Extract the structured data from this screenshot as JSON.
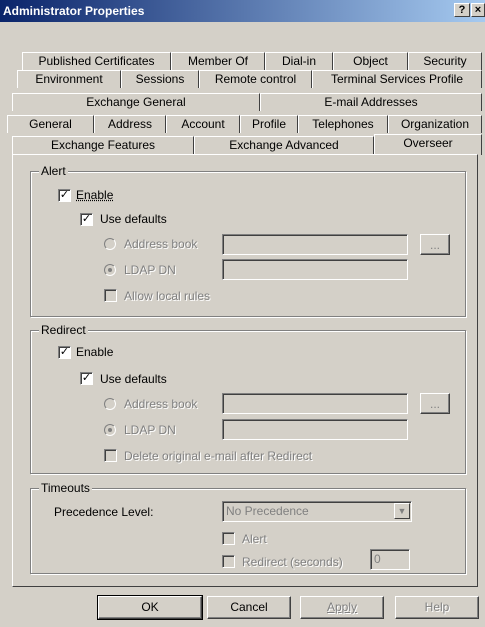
{
  "window": {
    "title": "Administrator Properties",
    "help_btn": "?",
    "close_btn": "×"
  },
  "tabs": {
    "row1": [
      "Published Certificates",
      "Member Of",
      "Dial-in",
      "Object",
      "Security"
    ],
    "row2": [
      "Environment",
      "Sessions",
      "Remote control",
      "Terminal Services Profile"
    ],
    "row3": [
      "Exchange General",
      "E-mail Addresses"
    ],
    "row4": [
      "General",
      "Address",
      "Account",
      "Profile",
      "Telephones",
      "Organization"
    ],
    "row5": [
      "Exchange Features",
      "Exchange Advanced",
      "Overseer"
    ],
    "active": "Overseer"
  },
  "alert": {
    "legend": "Alert",
    "enable_label": "Enable",
    "enable_checked": true,
    "use_defaults_label": "Use defaults",
    "use_defaults_checked": true,
    "address_book_label": "Address book",
    "ldap_dn_label": "LDAP DN",
    "browse_label": "...",
    "allow_local_rules_label": "Allow local rules"
  },
  "redirect": {
    "legend": "Redirect",
    "enable_label": "Enable",
    "enable_checked": true,
    "use_defaults_label": "Use defaults",
    "use_defaults_checked": true,
    "address_book_label": "Address book",
    "ldap_dn_label": "LDAP DN",
    "browse_label": "...",
    "delete_original_label": "Delete original e-mail after Redirect"
  },
  "timeouts": {
    "legend": "Timeouts",
    "precedence_label": "Precedence Level:",
    "precedence_value": "No Precedence",
    "alert_label": "Alert",
    "redirect_label": "Redirect (seconds)",
    "redirect_seconds": "0"
  },
  "buttons": {
    "ok": "OK",
    "cancel": "Cancel",
    "apply": "Apply",
    "help": "Help"
  }
}
